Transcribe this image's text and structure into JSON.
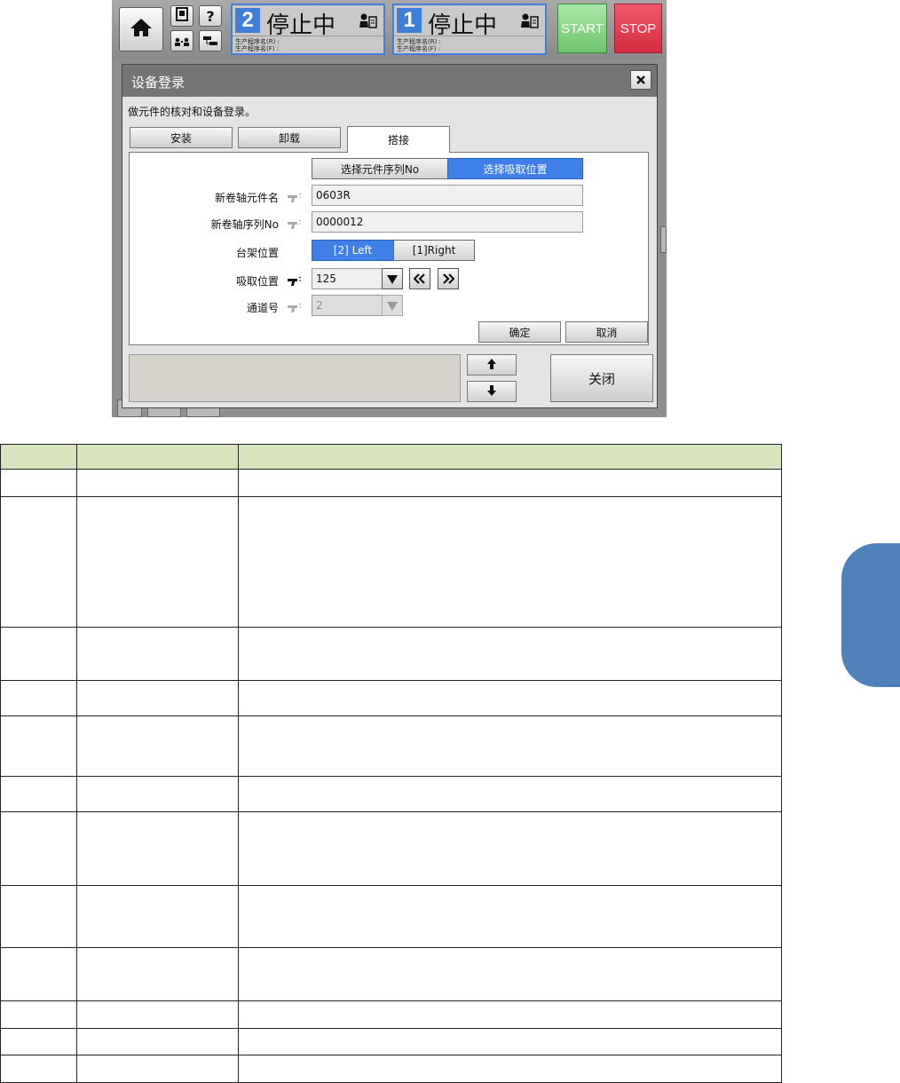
{
  "topbar": {
    "icons": [
      "home-icon",
      "operator-manual-icon",
      "help-icon",
      "operators-icon",
      "network-icon"
    ],
    "panels": [
      {
        "lane": "2",
        "status": "停止中",
        "sub1": "生产程序名(R) :",
        "sub2": "生产程序名(F) :"
      },
      {
        "lane": "1",
        "status": "停止中",
        "sub1": "生产程序名(R) :",
        "sub2": "生产程序名(F) :"
      }
    ],
    "start_label": "START",
    "stop_label": "STOP"
  },
  "dialog": {
    "title": "设备登录",
    "description": "做元件的核对和设备登录。",
    "tabs": [
      {
        "label": "安装",
        "active": false
      },
      {
        "label": "卸载",
        "active": false
      },
      {
        "label": "搭接",
        "active": true
      }
    ],
    "mode_buttons": {
      "serial": "选择元件序列No",
      "pickup": "选择吸取位置",
      "selected": "pickup"
    },
    "fields": {
      "new_reel_part_name": {
        "label": "新卷轴元件名",
        "value": "0603R"
      },
      "new_reel_serial": {
        "label": "新卷轴序列No",
        "value": "0000012"
      },
      "table_position": {
        "label": "台架位置",
        "options": [
          "[2] Left",
          "[1]Right"
        ],
        "selected": "[2] Left"
      },
      "pickup_position": {
        "label": "吸取位置",
        "value": "125"
      },
      "lane_number": {
        "label": "通道号",
        "value": "2"
      }
    },
    "ok_label": "确定",
    "cancel_label": "取消",
    "close_label": "关闭"
  },
  "colors": {
    "accent_blue": "#3f7fe8",
    "start_green": "#7fd07f",
    "stop_red": "#e23a4e",
    "table_header": "#d7e4bd",
    "side_tab": "#4f81bd"
  }
}
